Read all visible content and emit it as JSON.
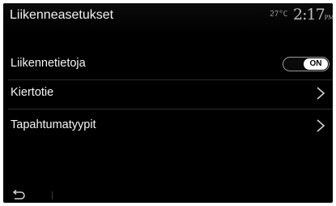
{
  "header": {
    "title": "Liikenneasetukset",
    "temperature": "27°C",
    "time": "2:17",
    "ampm": "PM"
  },
  "rows": [
    {
      "label": "Liikennetietoja",
      "control": "toggle",
      "toggle_state": "ON"
    },
    {
      "label": "Kiertotie",
      "control": "chevron",
      "icon": "chevron-right-icon"
    },
    {
      "label": "Tapahtumatyypit",
      "control": "chevron",
      "icon": "chevron-right-icon"
    }
  ],
  "footer": {
    "back_icon": "back-arrow-icon"
  },
  "colors": {
    "background": "#000000",
    "text": "#ffffff",
    "muted": "#8f8f8f",
    "separator": "#2c2c2c"
  }
}
